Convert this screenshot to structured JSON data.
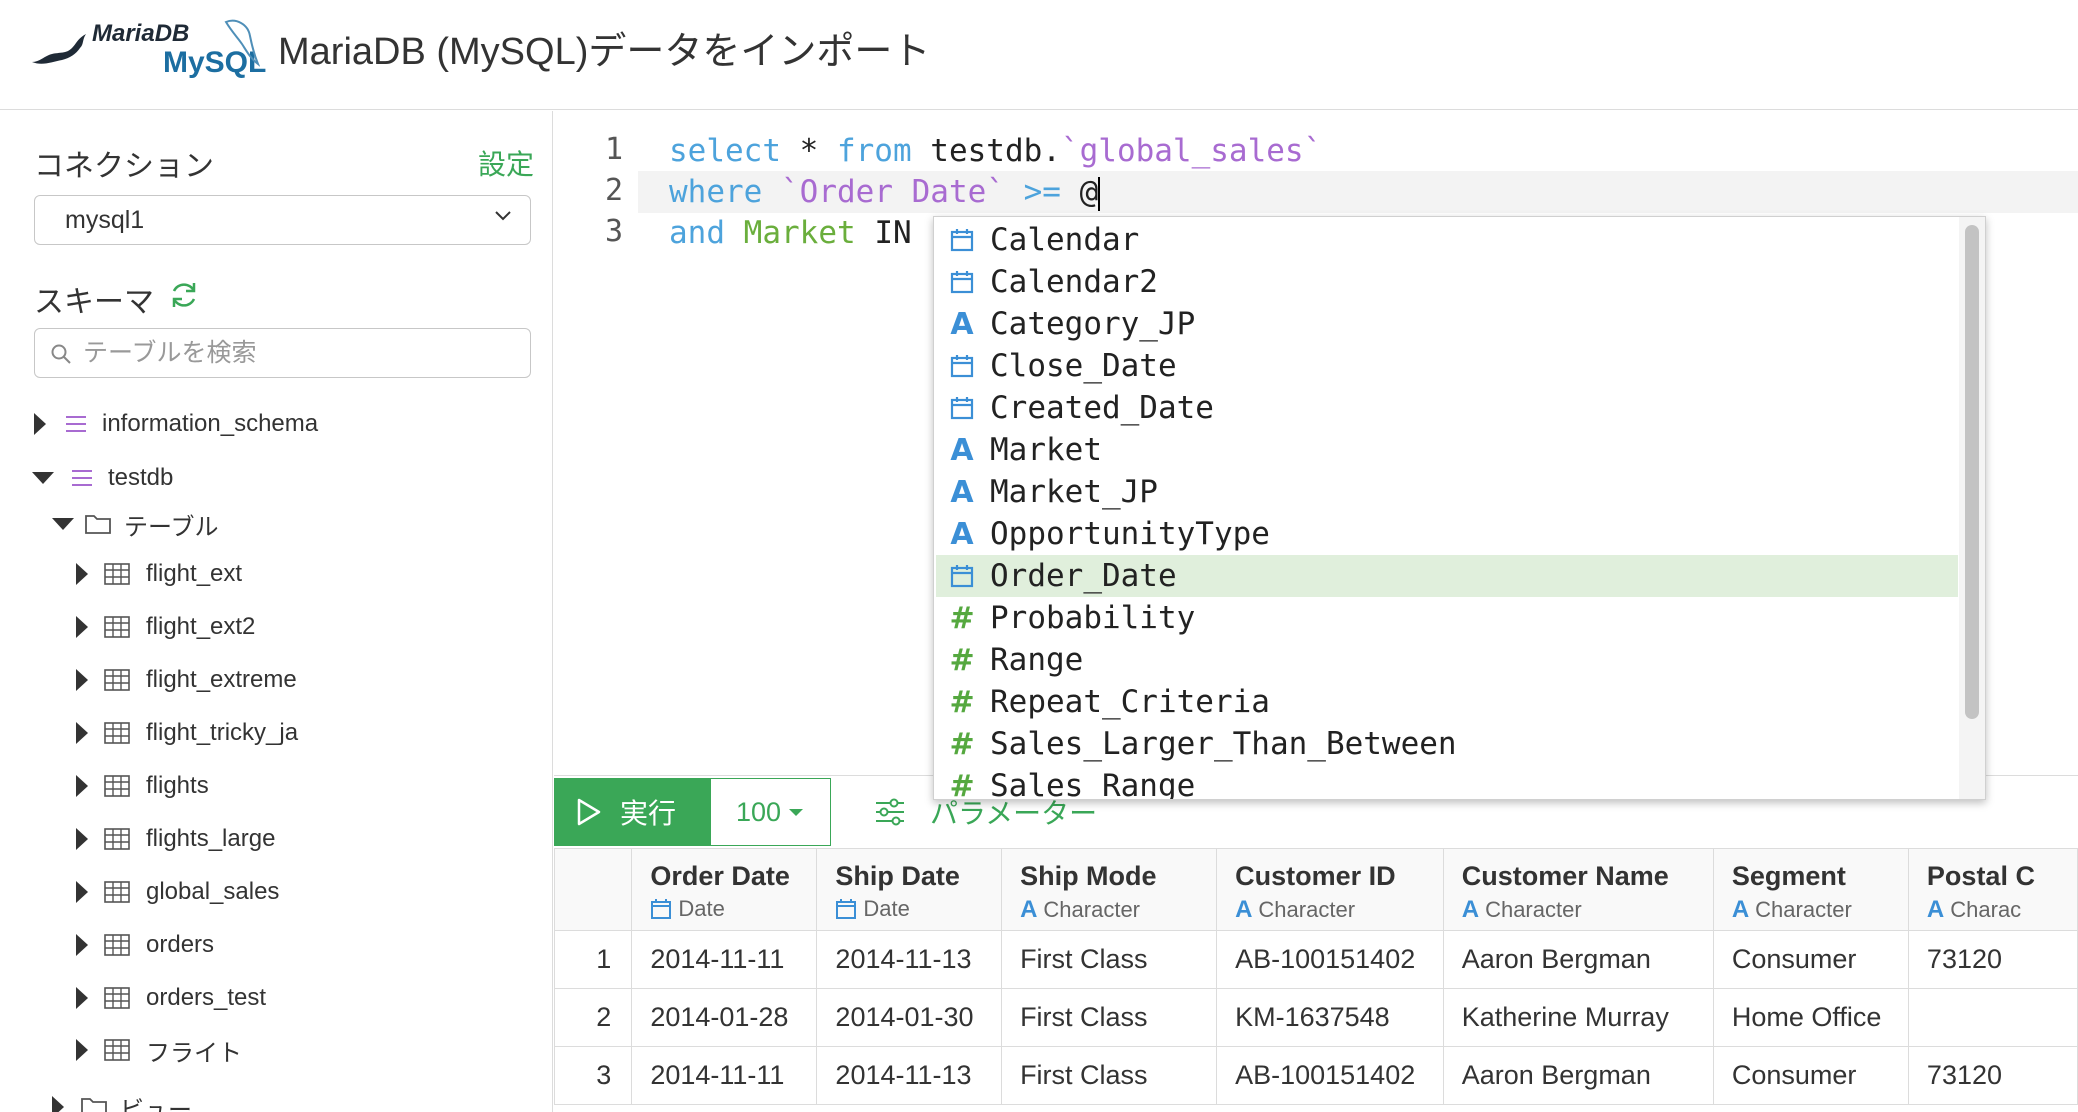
{
  "header": {
    "logo_mariadb": "MariaDB",
    "logo_mysql": "MySQL",
    "title": "MariaDB (MySQL)データをインポート"
  },
  "sidebar": {
    "connection_label": "コネクション",
    "settings_link": "設定",
    "connection_value": "mysql1",
    "schema_label": "スキーマ",
    "search_placeholder": "テーブルを検索",
    "tree": [
      {
        "label": "information_schema",
        "type": "schema",
        "expanded": false
      },
      {
        "label": "testdb",
        "type": "schema",
        "expanded": true
      },
      {
        "label": "テーブル",
        "type": "folder",
        "expanded": true
      },
      {
        "label": "flight_ext",
        "type": "table"
      },
      {
        "label": "flight_ext2",
        "type": "table"
      },
      {
        "label": "flight_extreme",
        "type": "table"
      },
      {
        "label": "flight_tricky_ja",
        "type": "table"
      },
      {
        "label": "flights",
        "type": "table"
      },
      {
        "label": "flights_large",
        "type": "table"
      },
      {
        "label": "global_sales",
        "type": "table"
      },
      {
        "label": "orders",
        "type": "table"
      },
      {
        "label": "orders_test",
        "type": "table"
      },
      {
        "label": "フライト",
        "type": "table"
      },
      {
        "label": "ビュー",
        "type": "folder",
        "expanded": false
      }
    ]
  },
  "editor": {
    "line_numbers": [
      "1",
      "2",
      "3"
    ],
    "line1": {
      "kw1": "select",
      "star": " * ",
      "kw2": "from",
      "db": " testdb.",
      "table": "`global_sales`"
    },
    "line2": {
      "kw1": "where",
      "col": "`Order Date`",
      "op": ">=",
      "at": "@"
    },
    "line3": {
      "kw1": "and",
      "col": "Market",
      "rest": " IN ("
    }
  },
  "autocomplete": {
    "items": [
      {
        "label": "Calendar",
        "icon": "calendar-icon"
      },
      {
        "label": "Calendar2",
        "icon": "calendar-icon"
      },
      {
        "label": "Category_JP",
        "icon": "character-icon"
      },
      {
        "label": "Close_Date",
        "icon": "calendar-icon"
      },
      {
        "label": "Created_Date",
        "icon": "calendar-icon"
      },
      {
        "label": "Market",
        "icon": "character-icon"
      },
      {
        "label": "Market_JP",
        "icon": "character-icon"
      },
      {
        "label": "OpportunityType",
        "icon": "character-icon"
      },
      {
        "label": "Order_Date",
        "icon": "calendar-icon",
        "selected": true
      },
      {
        "label": "Probability",
        "icon": "number-icon"
      },
      {
        "label": "Range",
        "icon": "number-icon"
      },
      {
        "label": "Repeat_Criteria",
        "icon": "number-icon"
      },
      {
        "label": "Sales_Larger_Than_Between",
        "icon": "number-icon"
      },
      {
        "label": "Sales_Range",
        "icon": "number-icon"
      }
    ]
  },
  "toolbar": {
    "run_label": "実行",
    "limit_value": "100",
    "params_label": "パラメーター"
  },
  "table": {
    "columns": [
      {
        "name": "Order Date",
        "type": "Date",
        "icon": "calendar-icon"
      },
      {
        "name": "Ship Date",
        "type": "Date",
        "icon": "calendar-icon"
      },
      {
        "name": "Ship Mode",
        "type": "Character",
        "icon": "character-icon"
      },
      {
        "name": "Customer ID",
        "type": "Character",
        "icon": "character-icon"
      },
      {
        "name": "Customer Name",
        "type": "Character",
        "icon": "character-icon"
      },
      {
        "name": "Segment",
        "type": "Character",
        "icon": "character-icon"
      },
      {
        "name": "Postal C",
        "type": "Charac",
        "icon": "character-icon"
      }
    ],
    "rows": [
      {
        "num": "1",
        "cells": [
          "2014-11-11",
          "2014-11-13",
          "First Class",
          "AB-100151402",
          "Aaron Bergman",
          "Consumer",
          "73120"
        ]
      },
      {
        "num": "2",
        "cells": [
          "2014-01-28",
          "2014-01-30",
          "First Class",
          "KM-1637548",
          "Katherine Murray",
          "Home Office",
          ""
        ]
      },
      {
        "num": "3",
        "cells": [
          "2014-11-11",
          "2014-11-13",
          "First Class",
          "AB-100151402",
          "Aaron Bergman",
          "Consumer",
          "73120"
        ]
      }
    ]
  },
  "colors": {
    "accent_green": "#3aa757",
    "keyword_blue": "#4da3dc",
    "string_purple": "#a86bd1",
    "column_green": "#6aae3c",
    "selected_row": "#e0efdc"
  }
}
